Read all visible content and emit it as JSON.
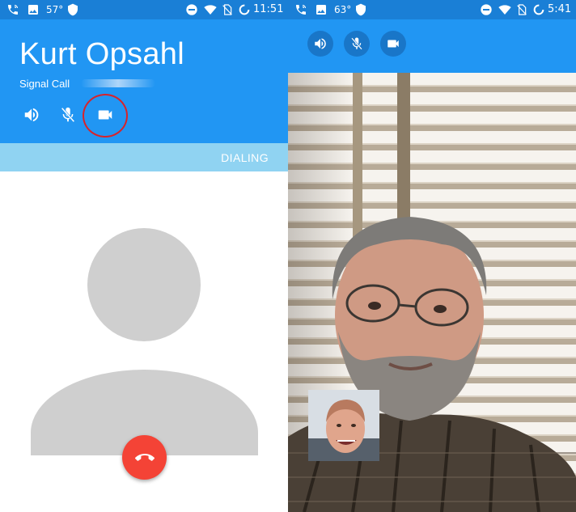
{
  "left": {
    "statusbar": {
      "temperature": "57°",
      "time": "11:51",
      "icons": [
        "phone-wifi-icon",
        "image-icon",
        "shield-icon",
        "do-not-disturb-icon",
        "wifi-icon",
        "no-sim-icon",
        "battery-ring-icon"
      ]
    },
    "call": {
      "contact_name": "Kurt Opsahl",
      "call_type": "Signal Call",
      "status": "DIALING"
    },
    "controls": [
      "speaker-icon",
      "mic-off-icon",
      "video-camera-icon"
    ],
    "hangup": "end-call-icon"
  },
  "right": {
    "statusbar": {
      "temperature": "63°",
      "time": "5:41",
      "icons": [
        "phone-wifi-icon",
        "image-icon",
        "shield-icon",
        "do-not-disturb-icon",
        "wifi-icon",
        "no-sim-icon",
        "battery-ring-icon"
      ]
    },
    "controls": [
      "speaker-icon",
      "mic-off-icon",
      "video-camera-icon"
    ]
  },
  "colors": {
    "status_bar": "#1a7fd6",
    "header": "#2196f3",
    "status_band": "#90d3f2",
    "avatar": "#cfcfcf",
    "hangup": "#f44336",
    "highlight": "#d8232a"
  }
}
